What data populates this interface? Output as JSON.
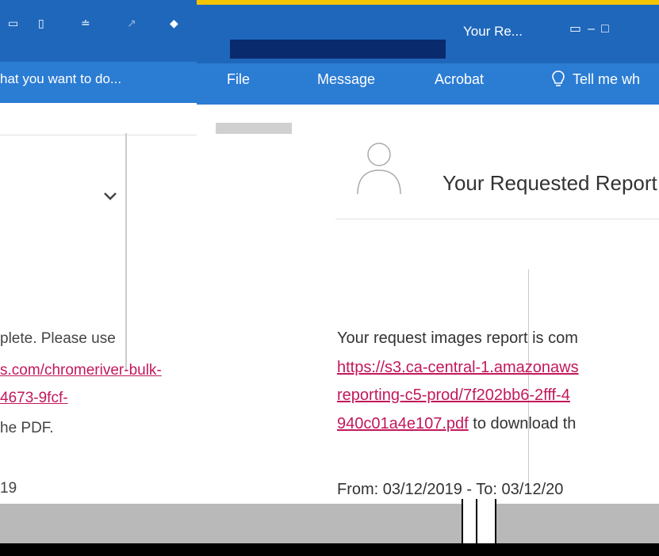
{
  "left_window": {
    "tell_me": "hat you want to do...",
    "body_lines": [
      {
        "text": "plete. Please use",
        "link": false
      },
      {
        "text": "s.com/chromeriver-bulk-",
        "link": true
      },
      {
        "text": "4673-9fcf-",
        "link": true
      },
      {
        "text": "he PDF.",
        "link": false
      },
      {
        "text": "19",
        "link": false
      }
    ]
  },
  "right_window": {
    "title": "Your Re...",
    "tabs": {
      "file": "File",
      "message": "Message",
      "acrobat": "Acrobat",
      "tell_me": "Tell me wh"
    },
    "subject": "Your Requested Report",
    "body": {
      "line1": "Your request images report is com",
      "link_line1": "https://s3.ca-central-1.amazonaws",
      "link_line2": "reporting-c5-prod/7f202bb6-2fff-4",
      "link_line3_link": "940c01a4e107.pdf",
      "link_line3_rest": " to download th",
      "date_line": "From: 03/12/2019 - To: 03/12/20"
    }
  },
  "colors": {
    "titlebar_blue": "#1e67bb",
    "ribbon_blue": "#2b7cd3",
    "link_pink": "#c2185b",
    "accent_yellow": "#f5c400"
  },
  "icons": [
    "save-icon",
    "undo-icon",
    "redo-icon",
    "lightbulb-icon",
    "chevron-down-icon",
    "avatar-icon"
  ]
}
